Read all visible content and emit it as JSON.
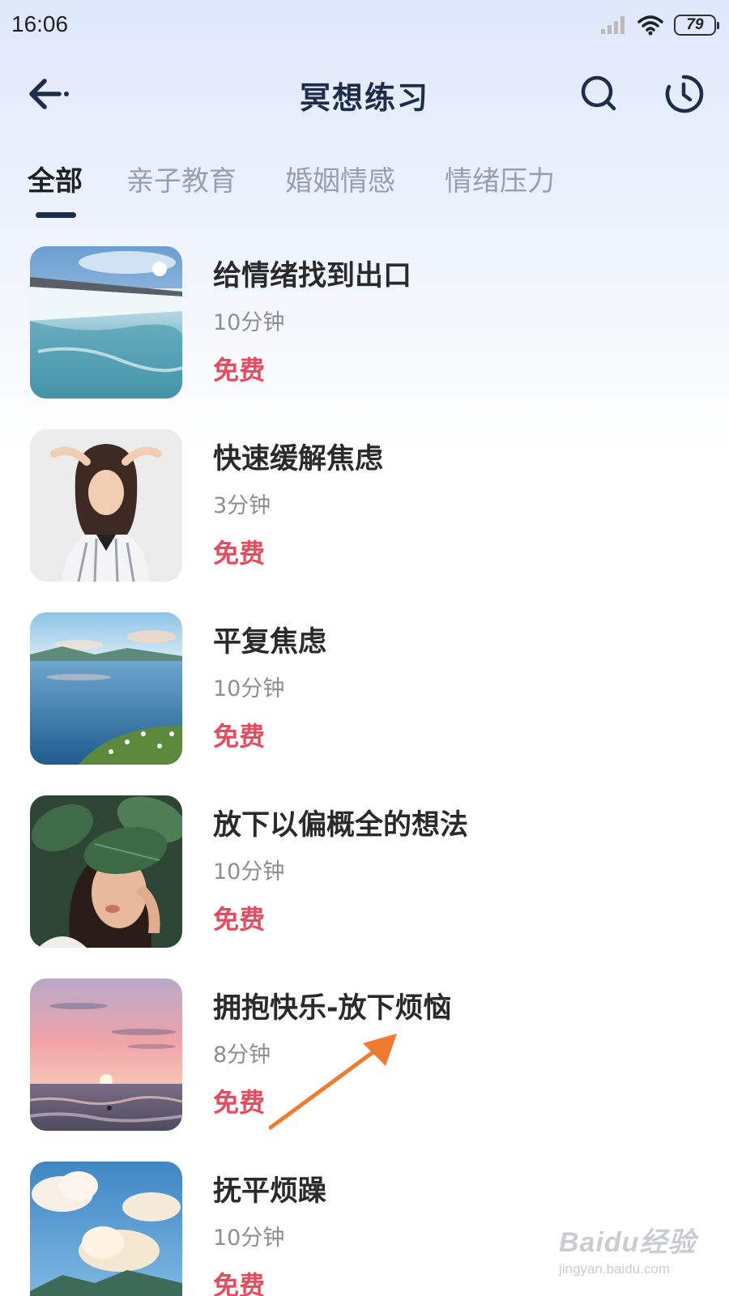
{
  "status_bar": {
    "time": "16:06",
    "battery": "79"
  },
  "header": {
    "title": "冥想练习",
    "icons": {
      "back": "back-arrow-icon",
      "search": "search-icon",
      "history": "clock-icon"
    }
  },
  "tabs": [
    {
      "label": "全部",
      "active": true
    },
    {
      "label": "亲子教育",
      "active": false
    },
    {
      "label": "婚姻情感",
      "active": false
    },
    {
      "label": "情绪压力",
      "active": false
    }
  ],
  "items": [
    {
      "title": "给情绪找到出口",
      "duration": "10分钟",
      "price": "免费"
    },
    {
      "title": "快速缓解焦虑",
      "duration": "3分钟",
      "price": "免费"
    },
    {
      "title": "平复焦虑",
      "duration": "10分钟",
      "price": "免费"
    },
    {
      "title": "放下以偏概全的想法",
      "duration": "10分钟",
      "price": "免费"
    },
    {
      "title": "拥抱快乐-放下烦恼",
      "duration": "8分钟",
      "price": "免费"
    },
    {
      "title": "抚平烦躁",
      "duration": "10分钟",
      "price": "免费"
    }
  ],
  "watermark": {
    "logo": "Baidu经验",
    "url": "jingyan.baidu.com"
  },
  "colors": {
    "title": "#1f2d4d",
    "price": "#e84a5f",
    "annotation_arrow": "#f07a2e"
  }
}
